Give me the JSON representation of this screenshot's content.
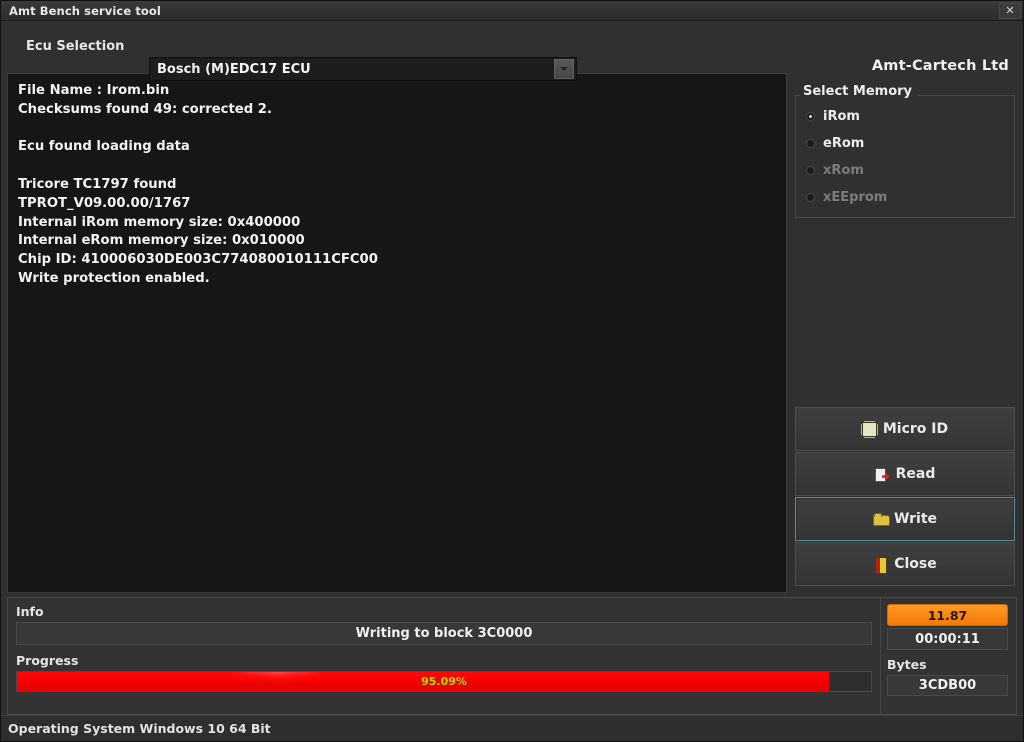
{
  "window": {
    "title": "Amt Bench service tool",
    "close_label": "✕"
  },
  "header": {
    "ecu_selection_label": "Ecu Selection",
    "ecu_selected": "Bosch (M)EDC17 ECU",
    "brand": "Amt-Cartech Ltd"
  },
  "log": {
    "lines": [
      "File Name : Irom.bin",
      "Checksums found 49: corrected 2.",
      "",
      "Ecu found loading data",
      "",
      "Tricore TC1797 found",
      "TPROT_V09.00.00/1767",
      "Internal iRom memory size: 0x400000",
      "Internal eRom memory size: 0x010000",
      "Chip ID: 410006030DE003C774080010111CFC00",
      "Write protection enabled."
    ]
  },
  "memory": {
    "group_title": "Select Memory",
    "options": [
      {
        "label": "iRom",
        "selected": true,
        "disabled": false
      },
      {
        "label": "eRom",
        "selected": false,
        "disabled": false
      },
      {
        "label": "xRom",
        "selected": false,
        "disabled": true
      },
      {
        "label": "xEEprom",
        "selected": false,
        "disabled": true
      }
    ]
  },
  "actions": {
    "buttons": [
      {
        "label": "Micro ID",
        "icon": "chip-icon",
        "focused": false
      },
      {
        "label": "Read",
        "icon": "read-icon",
        "focused": false
      },
      {
        "label": "Write",
        "icon": "folder-icon",
        "focused": true
      },
      {
        "label": "Close",
        "icon": "door-icon",
        "focused": false
      }
    ]
  },
  "bottom": {
    "info_label": "Info",
    "info_message": "Writing to block 3C0000",
    "progress_label": "Progress",
    "progress_percent_text": "95.09%",
    "progress_percent": 95.09,
    "voltage": "11.87",
    "elapsed_time": "00:00:11",
    "bytes_label": "Bytes",
    "bytes_value": "3CDB00"
  },
  "statusbar": {
    "text": "Operating System Windows 10 64 Bit"
  },
  "colors": {
    "progress_fill": "#ff1010",
    "progress_text": "#a8e000",
    "voltage_bg": "#f58a12",
    "focus_border": "#5f8f96"
  }
}
